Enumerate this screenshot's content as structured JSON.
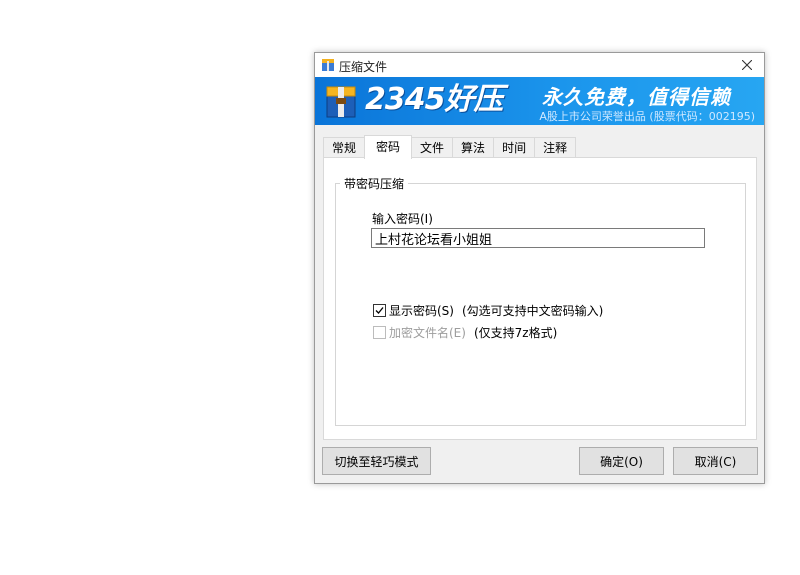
{
  "window": {
    "title": "压缩文件",
    "close_icon": "close-icon"
  },
  "banner": {
    "brand": "2345好压",
    "slogan": "永久免费，值得信赖",
    "sub": "A股上市公司荣誉出品 (股票代码：002195)",
    "colors": {
      "from": "#0a74d8",
      "to": "#27a6f2"
    }
  },
  "tabs": [
    {
      "label": "常规",
      "active": false
    },
    {
      "label": "密码",
      "active": true
    },
    {
      "label": "文件",
      "active": false
    },
    {
      "label": "算法",
      "active": false
    },
    {
      "label": "时间",
      "active": false
    },
    {
      "label": "注释",
      "active": false
    }
  ],
  "group": {
    "title": "带密码压缩",
    "password_label": "输入密码(I)",
    "password_value": "上村花论坛看小姐姐"
  },
  "options": {
    "show_password": {
      "label": "显示密码(S)",
      "note": "(勾选可支持中文密码输入)",
      "checked": true
    },
    "encrypt_names": {
      "label": "加密文件名(E)",
      "note": "(仅支持7z格式)",
      "checked": false,
      "disabled": true
    }
  },
  "buttons": {
    "mode": "切换至轻巧模式",
    "ok": "确定(O)",
    "cancel": "取消(C)"
  }
}
